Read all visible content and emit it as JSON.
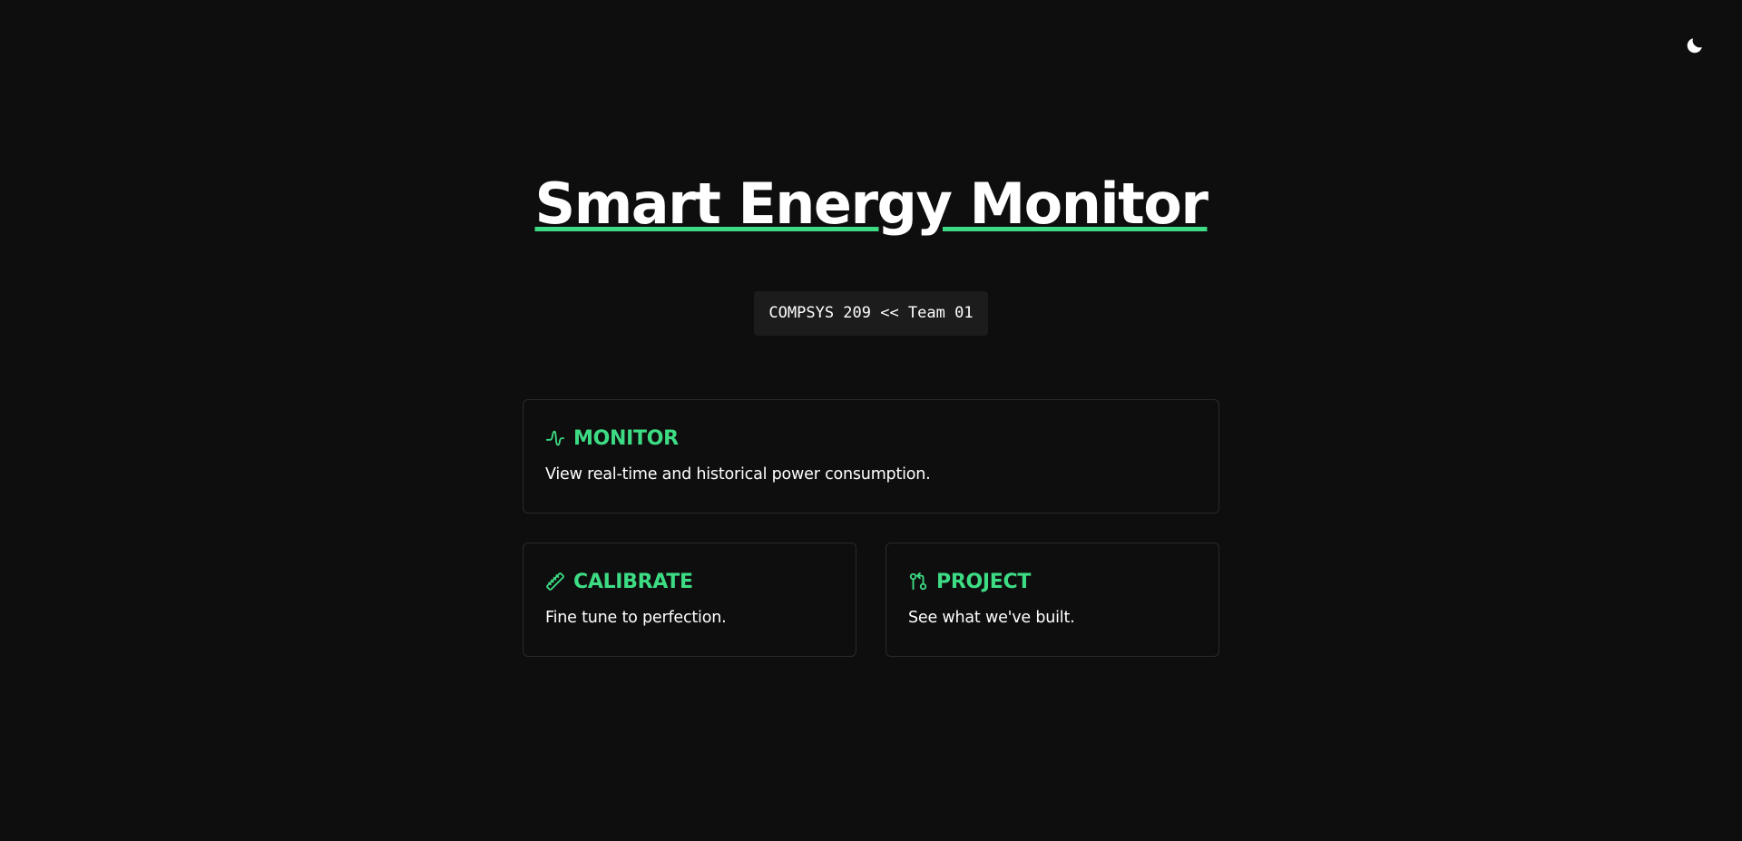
{
  "header": {
    "theme_toggle_icon": "moon-icon"
  },
  "hero": {
    "title": "Smart Energy Monitor",
    "badge": "COMPSYS 209 << Team 01"
  },
  "cards": {
    "monitor": {
      "icon": "waveform-icon",
      "title": "MONITOR",
      "description": "View real-time and historical power consumption."
    },
    "calibrate": {
      "icon": "ruler-icon",
      "title": "CALIBRATE",
      "description": "Fine tune to perfection."
    },
    "project": {
      "icon": "git-compare-icon",
      "title": "PROJECT",
      "description": "See what we've built."
    }
  },
  "colors": {
    "background": "#0e0e0e",
    "accent": "#3ddc84",
    "text": "#ffffff",
    "badge_background": "#1c1c1c",
    "card_border": "#2a2a2a"
  }
}
